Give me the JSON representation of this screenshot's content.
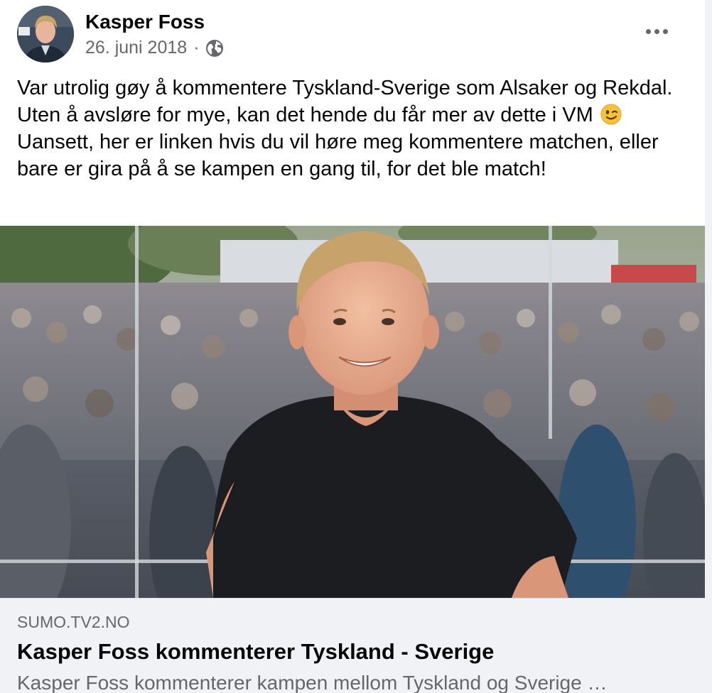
{
  "post": {
    "author": "Kasper Foss",
    "date": "26. juni 2018",
    "separator": "·",
    "audience_icon": "globe-icon",
    "more_icon": "more-options-icon",
    "text_part1": "Var utrolig gøy å kommentere Tyskland-Sverige som Alsaker og Rekdal. Uten å avsløre for mye, kan det hende du får mer av dette i VM",
    "emoji": "winking-face-emoji",
    "text_part2": "Uansett, her er linken hvis du vil høre meg kommentere matchen, eller bare er gira på å se kampen en gang til, for det ble match!"
  },
  "link_preview": {
    "domain": "SUMO.TV2.NO",
    "title": "Kasper Foss kommenterer Tyskland - Sverige",
    "description": "Kasper Foss kommenterer kampen mellom Tyskland og Sverige …"
  },
  "colors": {
    "text_primary": "#050505",
    "text_secondary": "#65676b",
    "caption_bg": "#f0f2f5"
  }
}
